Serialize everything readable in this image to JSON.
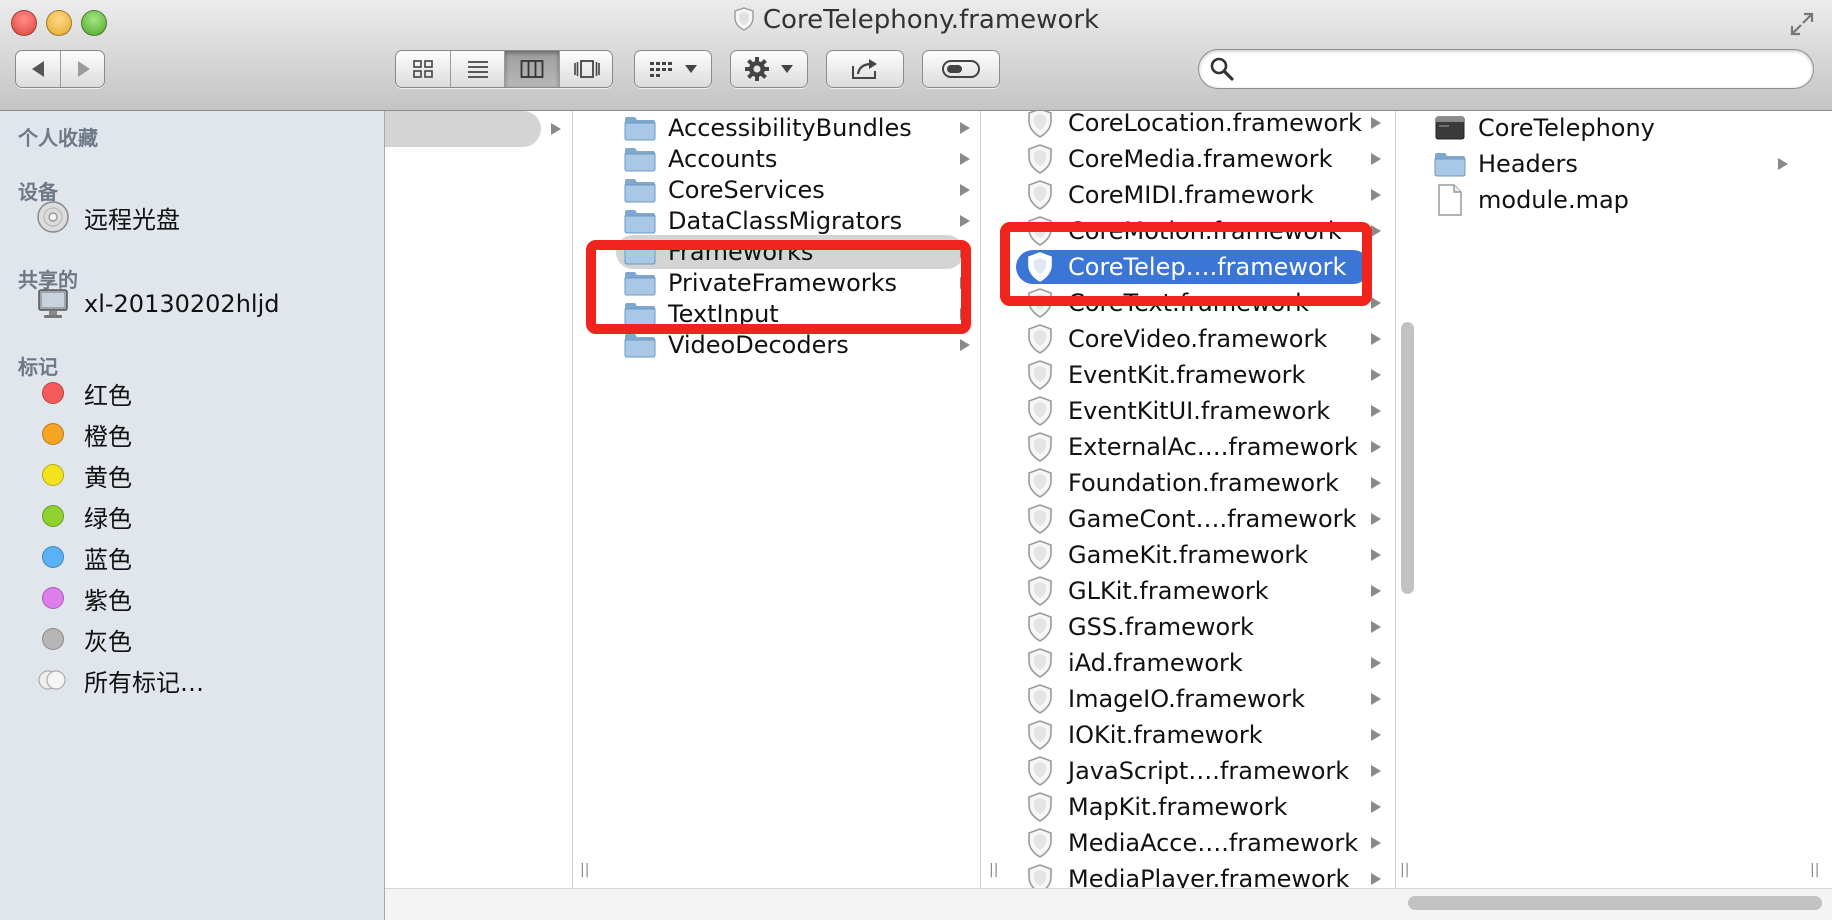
{
  "window": {
    "title": "CoreTelephony.framework",
    "icon": "framework-shield-icon"
  },
  "toolbar": {
    "nav": [
      {
        "icon": "back-arrow-icon"
      },
      {
        "icon": "forward-arrow-icon"
      }
    ],
    "view_modes": [
      {
        "icon": "icon-view-icon",
        "active": false
      },
      {
        "icon": "list-view-icon",
        "active": false
      },
      {
        "icon": "column-view-icon",
        "active": true
      },
      {
        "icon": "coverflow-view-icon",
        "active": false
      }
    ],
    "arrange_icon": "arrange-grid-icon",
    "action_icon": "gear-icon",
    "share_icon": "share-icon",
    "tags_icon": "tag-toggle-icon",
    "search": {
      "value": "",
      "placeholder": "",
      "icon": "magnifier-icon"
    }
  },
  "sidebar": {
    "favorites_header": "个人收藏",
    "devices_header": "设备",
    "devices": [
      {
        "label": "远程光盘",
        "icon": "remote-disc-icon"
      }
    ],
    "shared_header": "共享的",
    "shared": [
      {
        "label": "xl-20130202hljd",
        "icon": "network-computer-icon"
      }
    ],
    "tags_header": "标记",
    "tags": [
      {
        "label": "红色",
        "color": "#f55a5a"
      },
      {
        "label": "橙色",
        "color": "#f7a324"
      },
      {
        "label": "黄色",
        "color": "#f2e31e"
      },
      {
        "label": "绿色",
        "color": "#8fd12e"
      },
      {
        "label": "蓝色",
        "color": "#5ab2f5"
      },
      {
        "label": "紫色",
        "color": "#de7ded"
      },
      {
        "label": "灰色",
        "color": "#b6b6b6"
      },
      {
        "label": "所有标记…",
        "color": "all"
      }
    ]
  },
  "columns": {
    "col2": [
      {
        "label": "AccessibilityBundles"
      },
      {
        "label": "Accounts"
      },
      {
        "label": "CoreServices"
      },
      {
        "label": "DataClassMigrators"
      },
      {
        "label": "Frameworks",
        "selected": true
      },
      {
        "label": "PrivateFrameworks"
      },
      {
        "label": "TextInput"
      },
      {
        "label": "VideoDecoders"
      }
    ],
    "col3": [
      {
        "label": "CoreLocation.framework"
      },
      {
        "label": "CoreMedia.framework"
      },
      {
        "label": "CoreMIDI.framework"
      },
      {
        "label": "CoreMotion.framework"
      },
      {
        "label": "CoreTelep….framework",
        "selected": true
      },
      {
        "label": "CoreText.framework"
      },
      {
        "label": "CoreVideo.framework"
      },
      {
        "label": "EventKit.framework"
      },
      {
        "label": "EventKitUI.framework"
      },
      {
        "label": "ExternalAc….framework"
      },
      {
        "label": "Foundation.framework"
      },
      {
        "label": "GameCont….framework"
      },
      {
        "label": "GameKit.framework"
      },
      {
        "label": "GLKit.framework"
      },
      {
        "label": "GSS.framework"
      },
      {
        "label": "iAd.framework"
      },
      {
        "label": "ImageIO.framework"
      },
      {
        "label": "IOKit.framework"
      },
      {
        "label": "JavaScript….framework"
      },
      {
        "label": "MapKit.framework"
      },
      {
        "label": "MediaAcce….framework"
      },
      {
        "label": "MediaPlayer.framework"
      }
    ],
    "col4": [
      {
        "label": "CoreTelephony",
        "icon": "executable-icon"
      },
      {
        "label": "Headers",
        "icon": "folder-icon"
      },
      {
        "label": "module.map",
        "icon": "document-icon"
      }
    ]
  },
  "colors": {
    "selection_blue": "#3b76d6",
    "selection_gray": "#d4d4d4",
    "annotation_red": "#f0241c",
    "sidebar_bg": "#e1e6ed"
  }
}
